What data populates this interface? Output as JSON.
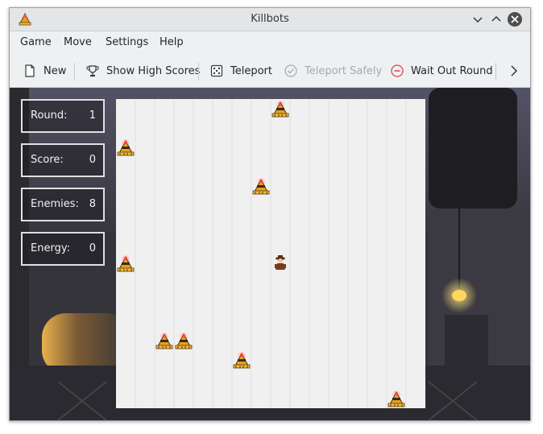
{
  "window": {
    "title": "Killbots"
  },
  "menubar": {
    "items": [
      "Game",
      "Move",
      "Settings",
      "Help"
    ]
  },
  "toolbar": {
    "new_label": "New",
    "high_scores_label": "Show High Scores",
    "teleport_label": "Teleport",
    "teleport_safely_label": "Teleport Safely",
    "wait_out_round_label": "Wait Out Round"
  },
  "stats": {
    "round": {
      "label": "Round:",
      "value": "1"
    },
    "score": {
      "label": "Score:",
      "value": "0"
    },
    "enemies": {
      "label": "Enemies:",
      "value": "8"
    },
    "energy": {
      "label": "Energy:",
      "value": "0"
    }
  },
  "board": {
    "columns": 16,
    "rows": 16,
    "hero": {
      "col": 8,
      "row": 8
    },
    "robots": [
      {
        "col": 8,
        "row": 0
      },
      {
        "col": 0,
        "row": 2
      },
      {
        "col": 7,
        "row": 4
      },
      {
        "col": 0,
        "row": 8
      },
      {
        "col": 2,
        "row": 12
      },
      {
        "col": 3,
        "row": 12
      },
      {
        "col": 6,
        "row": 13
      },
      {
        "col": 14,
        "row": 15
      }
    ]
  },
  "colors": {
    "board_bg": "#f0f0f0",
    "grid_line": "#dcdcdc",
    "scene_dark": "#2d2c31",
    "lamp": "#ffe27a"
  }
}
